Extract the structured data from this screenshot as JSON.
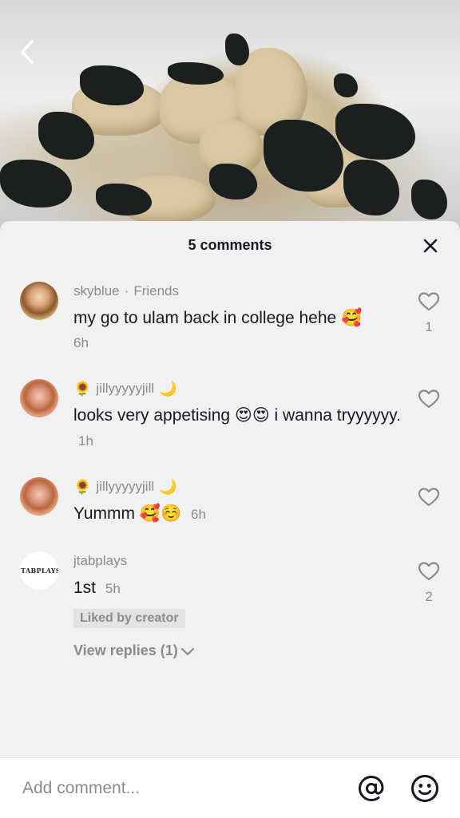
{
  "header": {
    "comment_count_title": "5 comments"
  },
  "comments": [
    {
      "username": "skyblue",
      "relation": "Friends",
      "text": "my go to ulam back in college hehe",
      "text_emoji": "🥰",
      "time": "6h",
      "likes": "1"
    },
    {
      "prefix_emoji": "🌻",
      "username": "jillyyyyyjill",
      "suffix_emoji": "🌙",
      "text": "looks very appetising 😍😍 i wanna tryyyyyy.",
      "time": "1h",
      "likes": ""
    },
    {
      "prefix_emoji": "🌻",
      "username": "jillyyyyyjill",
      "suffix_emoji": "🌙",
      "text": "Yummm 🥰☺️",
      "time": "6h",
      "likes": ""
    },
    {
      "username": "jtabplays",
      "avatar_text": "JTABPLAYS",
      "text": "1st",
      "time": "5h",
      "likes": "2",
      "badge": "Liked by creator",
      "view_replies": "View replies (1)"
    }
  ],
  "input": {
    "placeholder": "Add comment..."
  },
  "icons": {
    "back": "chevron-left-icon",
    "close": "close-icon",
    "like": "heart-outline-icon",
    "mention": "at-sign-icon",
    "emoji": "smiley-icon"
  },
  "colors": {
    "panel_bg": "#f1f1f2",
    "primary_text": "#161823",
    "secondary_text": "#8a8b91",
    "input_bg": "#ffffff"
  }
}
